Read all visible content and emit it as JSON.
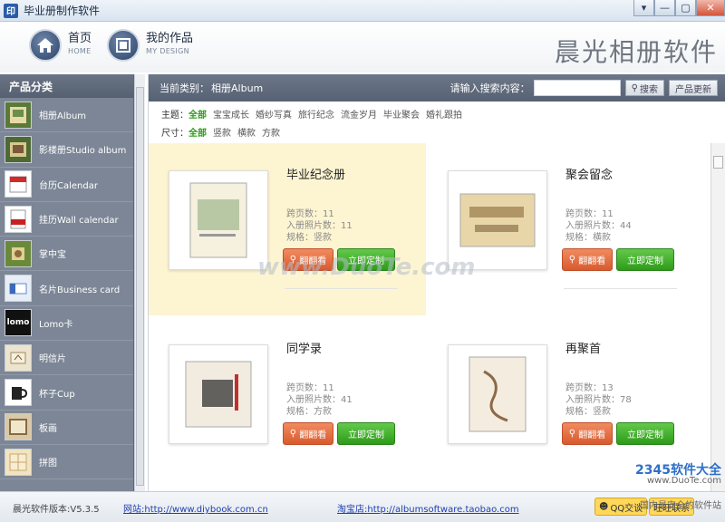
{
  "window": {
    "title": "毕业册制作软件",
    "app_icon": "印",
    "buttons": [
      "▾",
      "—",
      "▢",
      "✕"
    ]
  },
  "header": {
    "nav": [
      {
        "cn": "首页",
        "en": "HOME",
        "icon": "home-icon"
      },
      {
        "cn": "我的作品",
        "en": "MY DESIGN",
        "icon": "album-icon"
      }
    ],
    "brand": "晨光相册软件"
  },
  "sidebar": {
    "title": "产品分类",
    "items": [
      {
        "label": "相册Album"
      },
      {
        "label": "影楼册Studio album"
      },
      {
        "label": "台历Calendar"
      },
      {
        "label": "挂历Wall calendar"
      },
      {
        "label": "掌中宝"
      },
      {
        "label": "名片Business card"
      },
      {
        "label": "Lomo卡"
      },
      {
        "label": "明信片"
      },
      {
        "label": "杯子Cup"
      },
      {
        "label": "板画"
      },
      {
        "label": "拼图"
      }
    ]
  },
  "content": {
    "current_label": "当前类别：",
    "current_value": "相册Album",
    "search_label": "请输入搜索内容：",
    "search_value": "",
    "search_button": "搜索",
    "update_button": "产品更新",
    "filters": {
      "theme_label": "主题：",
      "themes": [
        "全部",
        "宝宝成长",
        "婚纱写真",
        "旅行纪念",
        "流金岁月",
        "毕业聚会",
        "婚礼跟拍"
      ],
      "size_label": "尺寸：",
      "sizes": [
        "全部",
        "竖款",
        "横款",
        "方款"
      ]
    }
  },
  "products": [
    {
      "title": "毕业纪念册",
      "pages": "跨页数：11",
      "photos": "入册照片数：11",
      "spec": "规格：竖款",
      "flip": "翻翻看",
      "custom": "立即定制"
    },
    {
      "title": "聚会留念",
      "pages": "跨页数：11",
      "photos": "入册照片数：44",
      "spec": "规格：横款",
      "flip": "翻翻看",
      "custom": "立即定制"
    },
    {
      "title": "同学录",
      "pages": "跨页数：11",
      "photos": "入册照片数：41",
      "spec": "规格：方款",
      "flip": "翻翻看",
      "custom": "立即定制"
    },
    {
      "title": "再聚首",
      "pages": "跨页数：13",
      "photos": "入册照片数：78",
      "spec": "规格：竖款",
      "flip": "翻翻看",
      "custom": "立即定制"
    }
  ],
  "status": {
    "version": "晨光软件版本:V5.3.5",
    "site_label": "网站:",
    "site_url": "http://www.diybook.com.cn",
    "shop_label": "淘宝店:",
    "shop_url": "http://albumsoftware.taobao.com",
    "qq": "QQ交谈",
    "contact": "旺旺联系"
  },
  "watermark": {
    "center": "www.DuoTe.com",
    "corner_big": "2345软件大全",
    "corner_url": "www.DuoTe.com",
    "corner_slogan": "国内最安全的软件站"
  },
  "colors": {
    "sidebar_bg": "#7c8696",
    "active_filter": "#2e9b16",
    "flip_btn": "#e56e3f",
    "custom_btn": "#3fac28",
    "highlight_card": "#fdf5d2"
  }
}
